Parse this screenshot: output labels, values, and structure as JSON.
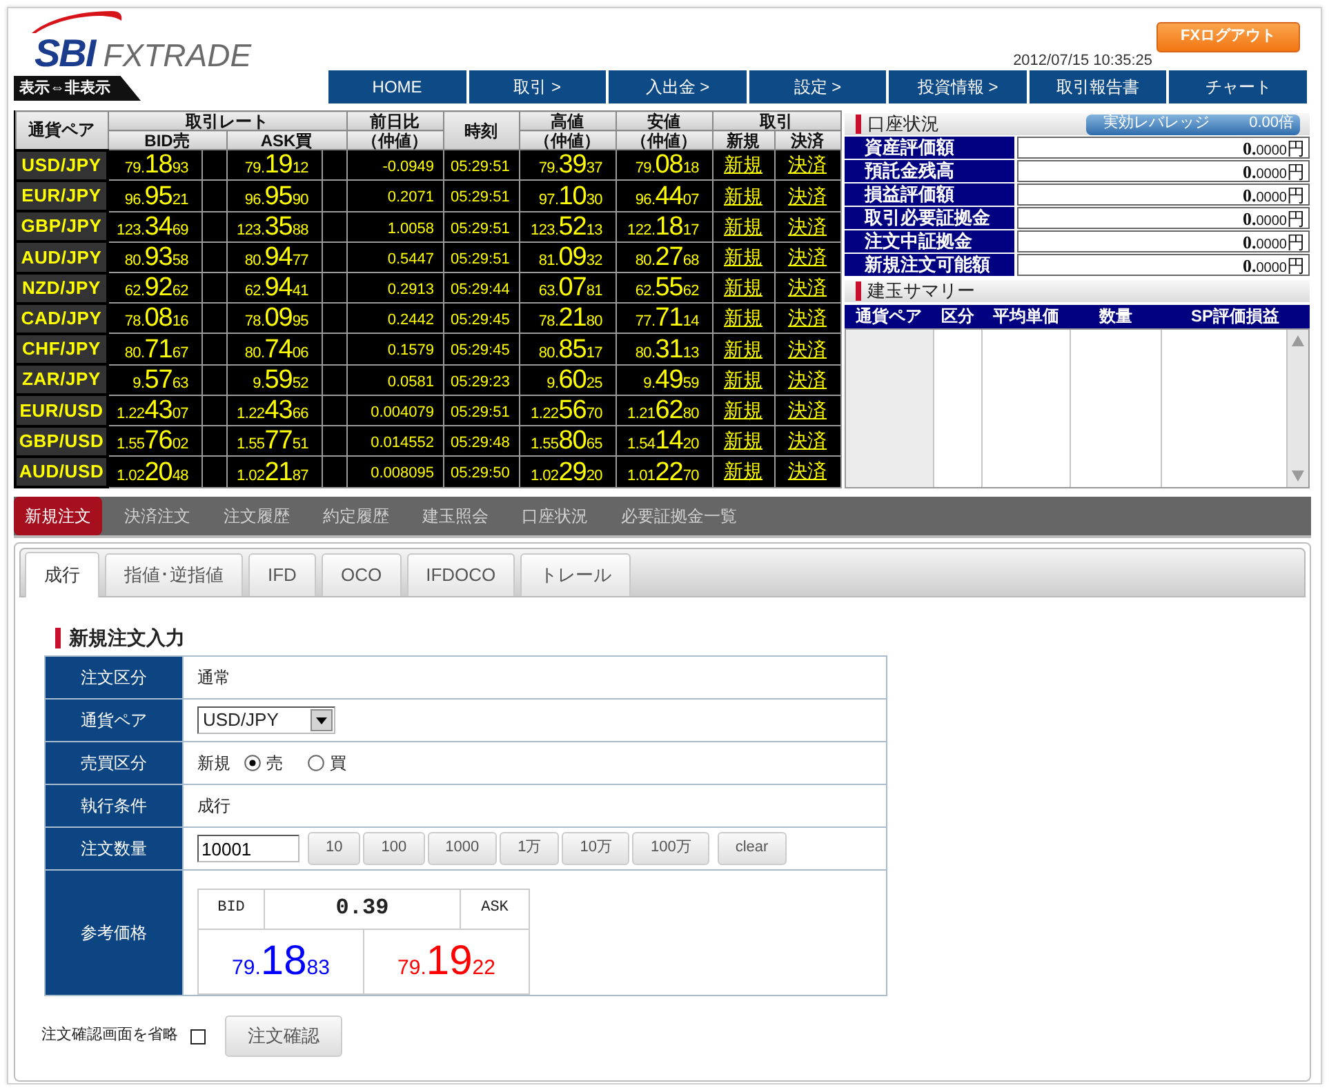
{
  "header": {
    "logo_brand": "SBI",
    "logo_product": "FXTRADE",
    "datetime": "2012/07/15 10:35:25",
    "logout": "FXログアウト",
    "toggle": "表示⇔非表示"
  },
  "nav": [
    "HOME",
    "取引 >",
    "入出金 >",
    "設定 >",
    "投資情報 >",
    "取引報告書",
    "チャート"
  ],
  "rate_board": {
    "headers": {
      "pair": "通貨ペア",
      "rate": "取引レート",
      "bid": "BID売",
      "ask": "ASK買",
      "change": "前日比",
      "change_sub": "（仲値）",
      "time": "時刻",
      "high": "高値",
      "high_sub": "（仲値）",
      "low": "安値",
      "low_sub": "（仲値）",
      "trade": "取引",
      "trade_new": "新規",
      "trade_settle": "決済"
    },
    "rows": [
      {
        "pair": "USD/JPY",
        "bid": [
          "79.",
          "18",
          "93"
        ],
        "ask": [
          "79.",
          "19",
          "12"
        ],
        "change": "-0.0949",
        "time": "05:29:51",
        "high": [
          "79.",
          "39",
          "37"
        ],
        "low": [
          "79.",
          "08",
          "18"
        ],
        "new_label": "新規",
        "settle_label": "決済"
      },
      {
        "pair": "EUR/JPY",
        "bid": [
          "96.",
          "95",
          "21"
        ],
        "ask": [
          "96.",
          "95",
          "90"
        ],
        "change": "0.2071",
        "time": "05:29:51",
        "high": [
          "97.",
          "10",
          "30"
        ],
        "low": [
          "96.",
          "44",
          "07"
        ],
        "new_label": "新規",
        "settle_label": "決済"
      },
      {
        "pair": "GBP/JPY",
        "bid": [
          "123.",
          "34",
          "69"
        ],
        "ask": [
          "123.",
          "35",
          "88"
        ],
        "change": "1.0058",
        "time": "05:29:51",
        "high": [
          "123.",
          "52",
          "13"
        ],
        "low": [
          "122.",
          "18",
          "17"
        ],
        "new_label": "新規",
        "settle_label": "決済"
      },
      {
        "pair": "AUD/JPY",
        "bid": [
          "80.",
          "93",
          "58"
        ],
        "ask": [
          "80.",
          "94",
          "77"
        ],
        "change": "0.5447",
        "time": "05:29:51",
        "high": [
          "81.",
          "09",
          "32"
        ],
        "low": [
          "80.",
          "27",
          "68"
        ],
        "new_label": "新規",
        "settle_label": "決済"
      },
      {
        "pair": "NZD/JPY",
        "bid": [
          "62.",
          "92",
          "62"
        ],
        "ask": [
          "62.",
          "94",
          "41"
        ],
        "change": "0.2913",
        "time": "05:29:44",
        "high": [
          "63.",
          "07",
          "81"
        ],
        "low": [
          "62.",
          "55",
          "62"
        ],
        "new_label": "新規",
        "settle_label": "決済"
      },
      {
        "pair": "CAD/JPY",
        "bid": [
          "78.",
          "08",
          "16"
        ],
        "ask": [
          "78.",
          "09",
          "95"
        ],
        "change": "0.2442",
        "time": "05:29:45",
        "high": [
          "78.",
          "21",
          "80"
        ],
        "low": [
          "77.",
          "71",
          "14"
        ],
        "new_label": "新規",
        "settle_label": "決済"
      },
      {
        "pair": "CHF/JPY",
        "bid": [
          "80.",
          "71",
          "67"
        ],
        "ask": [
          "80.",
          "74",
          "06"
        ],
        "change": "0.1579",
        "time": "05:29:45",
        "high": [
          "80.",
          "85",
          "17"
        ],
        "low": [
          "80.",
          "31",
          "13"
        ],
        "new_label": "新規",
        "settle_label": "決済"
      },
      {
        "pair": "ZAR/JPY",
        "bid": [
          "9.",
          "57",
          "63"
        ],
        "ask": [
          "9.",
          "59",
          "52"
        ],
        "change": "0.0581",
        "time": "05:29:23",
        "high": [
          "9.",
          "60",
          "25"
        ],
        "low": [
          "9.",
          "49",
          "59"
        ],
        "new_label": "新規",
        "settle_label": "決済"
      },
      {
        "pair": "EUR/USD",
        "bid": [
          "1.22",
          "43",
          "07"
        ],
        "ask": [
          "1.22",
          "43",
          "66"
        ],
        "change": "0.004079",
        "time": "05:29:51",
        "high": [
          "1.22",
          "56",
          "70"
        ],
        "low": [
          "1.21",
          "62",
          "80"
        ],
        "new_label": "新規",
        "settle_label": "決済"
      },
      {
        "pair": "GBP/USD",
        "bid": [
          "1.55",
          "76",
          "02"
        ],
        "ask": [
          "1.55",
          "77",
          "51"
        ],
        "change": "0.014552",
        "time": "05:29:48",
        "high": [
          "1.55",
          "80",
          "65"
        ],
        "low": [
          "1.54",
          "14",
          "20"
        ],
        "new_label": "新規",
        "settle_label": "決済"
      },
      {
        "pair": "AUD/USD",
        "bid": [
          "1.02",
          "20",
          "48"
        ],
        "ask": [
          "1.02",
          "21",
          "87"
        ],
        "change": "0.008095",
        "time": "05:29:50",
        "high": [
          "1.02",
          "29",
          "20"
        ],
        "low": [
          "1.01",
          "22",
          "70"
        ],
        "new_label": "新規",
        "settle_label": "決済"
      }
    ]
  },
  "account": {
    "title": "口座状況",
    "leverage_label": "実効レバレッジ",
    "leverage_value": "0.00倍",
    "items": [
      {
        "label": "資産評価額",
        "value_int": "0.",
        "value_dec": "0000",
        "unit": "円"
      },
      {
        "label": "預託金残高",
        "value_int": "0.",
        "value_dec": "0000",
        "unit": "円"
      },
      {
        "label": "損益評価額",
        "value_int": "0.",
        "value_dec": "0000",
        "unit": "円"
      },
      {
        "label": "取引必要証拠金",
        "value_int": "0.",
        "value_dec": "0000",
        "unit": "円"
      },
      {
        "label": "注文中証拠金",
        "value_int": "0.",
        "value_dec": "0000",
        "unit": "円"
      },
      {
        "label": "新規注文可能額",
        "value_int": "0.",
        "value_dec": "0000",
        "unit": "円"
      }
    ]
  },
  "positions": {
    "title": "建玉サマリー",
    "columns": [
      "通貨ペア",
      "区分",
      "平均単価",
      "数量",
      "SP評価損益"
    ]
  },
  "main_tabs": [
    {
      "label": "新規注文",
      "selected": true
    },
    {
      "label": "決済注文",
      "selected": false
    },
    {
      "label": "注文履歴",
      "selected": false
    },
    {
      "label": "約定履歴",
      "selected": false
    },
    {
      "label": "建玉照会",
      "selected": false
    },
    {
      "label": "口座状況",
      "selected": false
    },
    {
      "label": "必要証拠金一覧",
      "selected": false
    }
  ],
  "order_tabs": [
    {
      "label": "成行",
      "selected": true
    },
    {
      "label": "指値･逆指値",
      "selected": false
    },
    {
      "label": "IFD",
      "selected": false
    },
    {
      "label": "OCO",
      "selected": false
    },
    {
      "label": "IFDOCO",
      "selected": false
    },
    {
      "label": "トレール",
      "selected": false
    }
  ],
  "order_form": {
    "title": "新規注文入力",
    "rows": [
      {
        "kind": "text",
        "label": "注文区分",
        "value": "通常"
      },
      {
        "kind": "select",
        "label": "通貨ペア",
        "value": "USD/JPY"
      },
      {
        "kind": "radio",
        "label": "売買区分",
        "prefix": "新規",
        "options": [
          {
            "label": "売",
            "selected": true
          },
          {
            "label": "買",
            "selected": false
          }
        ]
      },
      {
        "kind": "text",
        "label": "執行条件",
        "value": "成行"
      },
      {
        "kind": "quantity",
        "label": "注文数量",
        "value": "10001",
        "buttons": [
          "10",
          "100",
          "1000",
          "1万",
          "10万",
          "100万",
          "clear"
        ]
      },
      {
        "kind": "price",
        "label": "参考価格",
        "bid_label": "BID",
        "spread": "0.39",
        "ask_label": "ASK",
        "bid": [
          "79.",
          "18",
          "83"
        ],
        "ask": [
          "79.",
          "19",
          "22"
        ]
      }
    ]
  },
  "footer": {
    "skip_label": "注文確認画面を省略",
    "skip_checked": false,
    "confirm": "注文確認"
  }
}
